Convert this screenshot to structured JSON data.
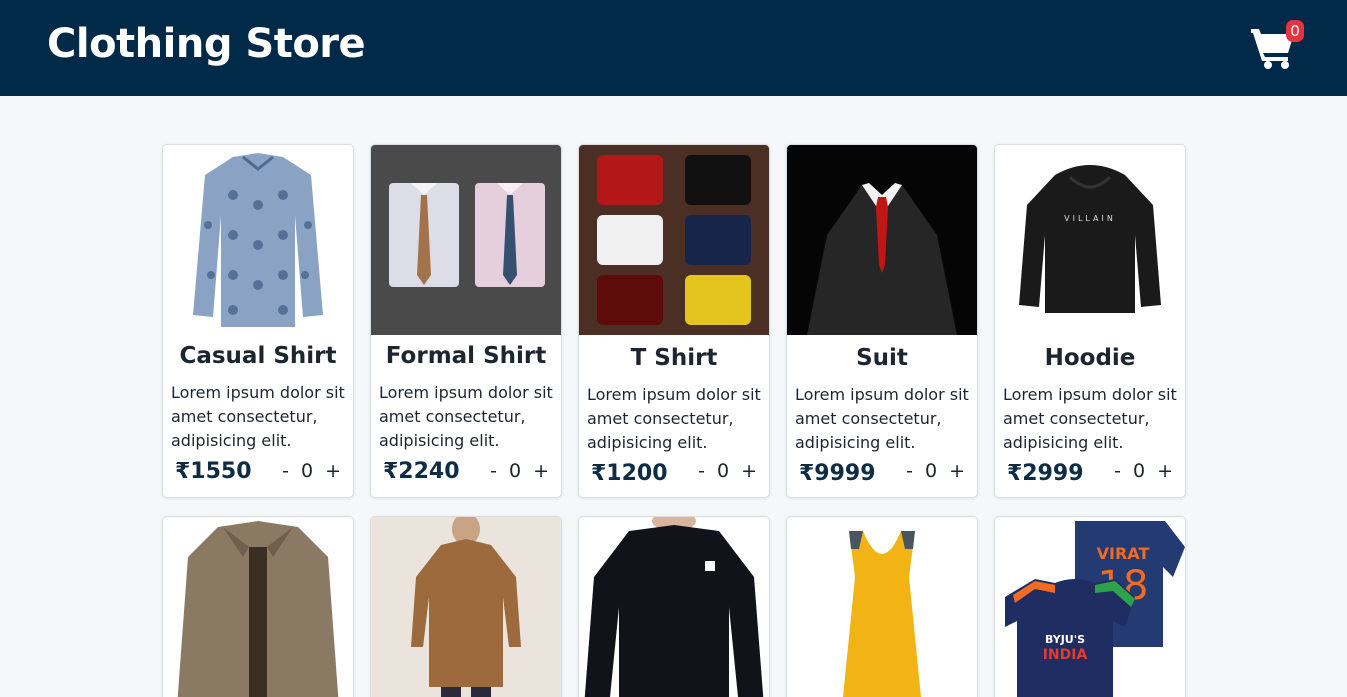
{
  "header": {
    "title": "Clothing Store",
    "cart_count": "0"
  },
  "products": [
    {
      "name": "Casual Shirt",
      "description": "Lorem ipsum dolor sit amet consectetur, adipisicing elit.",
      "price": "₹1550",
      "quantity": "0",
      "minus": "-",
      "plus": "+"
    },
    {
      "name": "Formal Shirt",
      "description": "Lorem ipsum dolor sit amet consectetur, adipisicing elit.",
      "price": "₹2240",
      "quantity": "0",
      "minus": "-",
      "plus": "+"
    },
    {
      "name": "T Shirt",
      "description": "Lorem ipsum dolor sit amet consectetur, adipisicing elit.",
      "price": "₹1200",
      "quantity": "0",
      "minus": "-",
      "plus": "+"
    },
    {
      "name": "Suit",
      "description": "Lorem ipsum dolor sit amet consectetur, adipisicing elit.",
      "price": "₹9999",
      "quantity": "0",
      "minus": "-",
      "plus": "+"
    },
    {
      "name": "Hoodie",
      "description": "Lorem ipsum dolor sit amet consectetur, adipisicing elit.",
      "price": "₹2999",
      "quantity": "0",
      "minus": "-",
      "plus": "+"
    }
  ],
  "second_row_images": [
    "jacket-image",
    "kurta-image",
    "compression-shirt-image",
    "tank-top-image",
    "cricket-jersey-image"
  ],
  "jersey_text": {
    "player": "VIRAT",
    "number": "18",
    "sponsor": "BYJU'S",
    "team": "INDIA"
  },
  "hoodie_text": "VILLAIN",
  "colors": {
    "header_bg": "#002a47",
    "badge": "#e5343f",
    "price": "#0e2c46"
  }
}
